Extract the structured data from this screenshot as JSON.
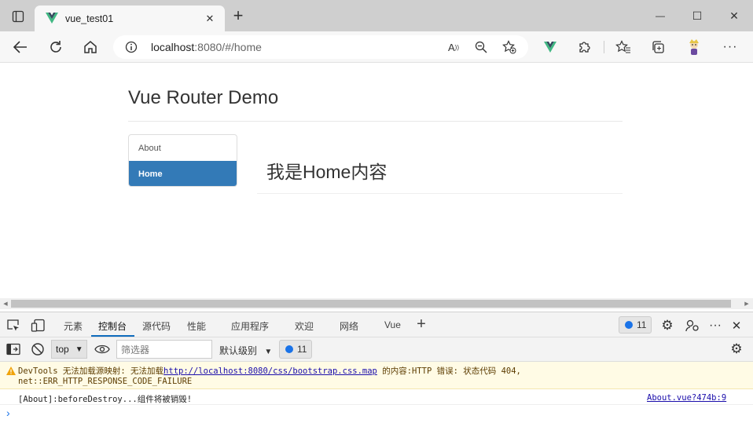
{
  "browser": {
    "tab_title": "vue_test01",
    "url_host": "localhost",
    "url_rest": ":8080/#/home",
    "new_tab": "+",
    "controls": {
      "minimize": "—",
      "maximize": "☐",
      "close": "✕"
    }
  },
  "page": {
    "heading": "Vue Router Demo",
    "nav": [
      {
        "label": "About",
        "active": false
      },
      {
        "label": "Home",
        "active": true
      }
    ],
    "content": "我是Home内容"
  },
  "devtools": {
    "tabs": [
      "元素",
      "控制台",
      "源代码",
      "性能",
      "应用程序",
      "欢迎",
      "网络",
      "Vue"
    ],
    "active_tab": "控制台",
    "add_tab": "+",
    "issues_count": "11",
    "context": "top",
    "filter_placeholder": "筛选器",
    "level_label": "默认级别",
    "toolbar_issues_count": "11",
    "console": {
      "warning_prefix": "DevTools 无法加载源映射: 无法加载",
      "warning_link": "http://localhost:8080/css/bootstrap.css.map",
      "warning_suffix": " 的内容:HTTP 错误: 状态代码 404,",
      "warning_line2": "net::ERR_HTTP_RESPONSE_CODE_FAILURE",
      "log_text": "[About]:beforeDestroy...组件将被销毁!",
      "log_source": "About.vue?474b:9"
    }
  },
  "colors": {
    "accent": "#337ab7",
    "devtools_accent": "#0f6cbd",
    "warning_bg": "#fffbe5"
  }
}
